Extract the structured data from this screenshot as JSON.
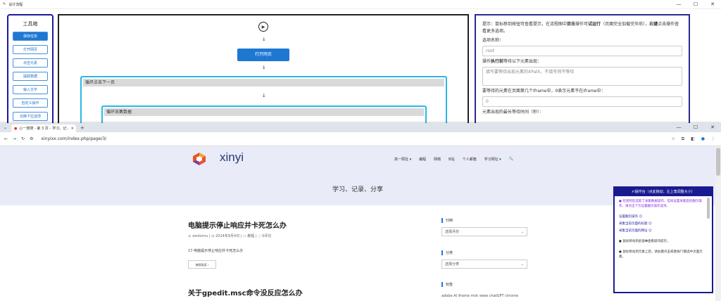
{
  "top_window": {
    "title": "设计流程",
    "controls": [
      "—",
      "☐",
      "✕"
    ]
  },
  "toolbox": {
    "title": "工具箱",
    "buttons": [
      "保存任务",
      "打开网页",
      "点击元素",
      "提取数据",
      "输入文字",
      "自定义操作",
      "切换下拉选项"
    ]
  },
  "flow": {
    "open_page": "打开网页",
    "loop1": "循环点击下一页",
    "loop2": "循环采集数据",
    "arrow": "↓"
  },
  "panel": {
    "hint_pre": "提示：鼠标移到按钮可查看提示，在流程图中",
    "hint_b1": "双击",
    "hint_mid": "操作可",
    "hint_b2": "试运行",
    "hint_post": "（页面完全加载完毕后），",
    "hint_b3": "右键",
    "hint_end": "点击操作查看更多选项。",
    "name_label": "选项名称：",
    "name_value": "root",
    "wait_label_pre": "操作",
    "wait_label_b": "执行前",
    "wait_label_post": "等待以下元素出现：",
    "wait_placeholder": "填写要等待出现元素的XPath，不填写则不等待",
    "iframe_label": "要等待的元素在页面第几个iframe中，0表示元素不在iframe中：",
    "iframe_value": "0",
    "timeout_label": "元素出现的最长等待时间（秒）："
  },
  "browser": {
    "tab_title": "心一搜搜 - 第 3 页 – 学习、记..",
    "tab_close": "✕",
    "new_tab": "+",
    "url": "xinyixx.com/index.php/page/3/",
    "controls": [
      "—",
      "☐",
      "✕"
    ]
  },
  "site": {
    "logo_text": "xinyi",
    "menu": [
      "高一网址 ▾",
      "编程",
      "网络",
      "B站",
      "个人邮箱",
      "学习网址 ▾",
      "🔍"
    ],
    "banner": "学习、记录、分享",
    "post1": {
      "title": "电脑提示停止响应并卡死怎么办",
      "author": "zentornu",
      "date": "2024年9月4日",
      "category": "教程",
      "comments": "0评论",
      "excerpt": "17-电脑提示停止响应并卡死怎么办",
      "more": "继续阅读 ›"
    },
    "post2": {
      "title": "关于gpedit.msc命令没反应怎么办"
    },
    "sidebar": {
      "archive_h": "归档",
      "archive_sel": "选择月份",
      "cat_h": "分类",
      "cat_sel": "选择分类",
      "tags_h": "标签",
      "tags": "adobe AI iframe mist www chatGPT chrome"
    }
  },
  "op_panel": {
    "title": "✍操作台（点此拖动，左上角调整大小）",
    "line1": "● 检测到您选取了采集数据操作，但尚设置采集后的翻页操作，请点击下方设置翻页操作选项。",
    "link1": "设置翻页操作 ☺",
    "link2": "采集当前页面的标题 ☺",
    "link3": "采集当前页面的网址 ☺",
    "line2": "● 鼠标移动到此窗❻查看操作提示。",
    "line3": "● 鼠标移动到元素上后，请右键点击或者按F7键选中页面元素。"
  }
}
